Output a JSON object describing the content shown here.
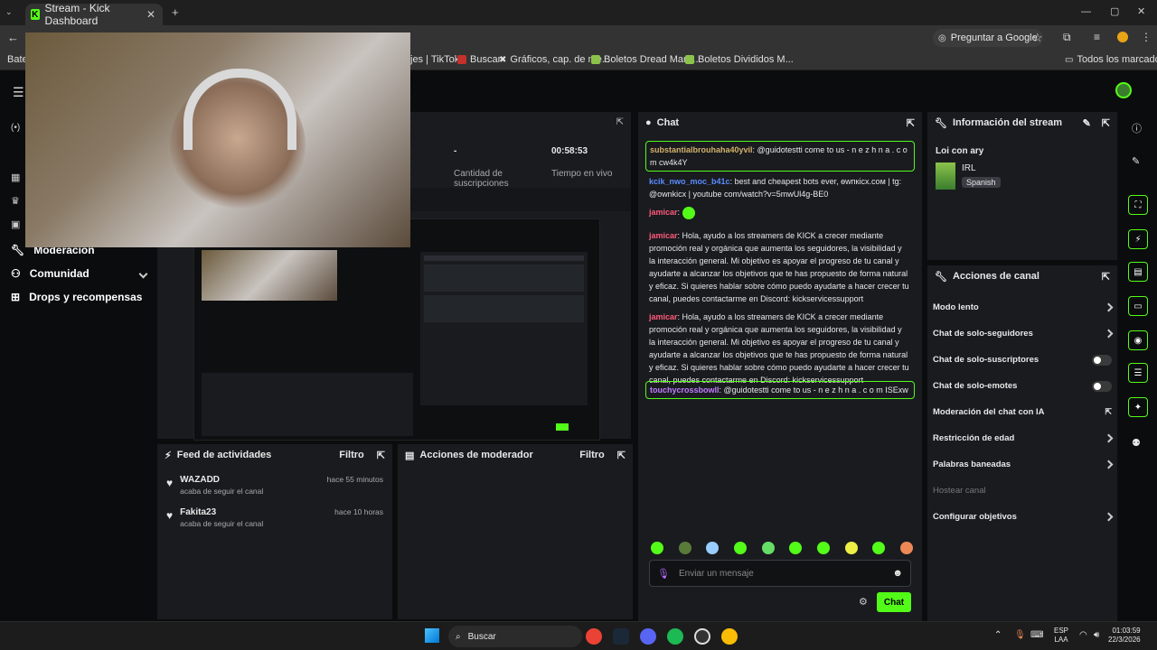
{
  "browser": {
    "tab_title": "Stream - Kick Dashboard",
    "ask_google": "Preguntar a Google",
    "bookmarks": [
      "Bater",
      "jes | TikTok",
      "Buscar",
      "Gráficos, cap. de me...",
      "Boletos Dread Mar-I...",
      "Boletos Divididos M..."
    ],
    "all_bookmarks": "Todos los marcadores"
  },
  "sidebar": {
    "items": [
      {
        "label": "Moderación",
        "icon": "wrench-icon"
      },
      {
        "label": "Comunidad",
        "icon": "people-icon"
      },
      {
        "label": "Drops y recompensas",
        "icon": "gift-icon"
      }
    ]
  },
  "stats": [
    {
      "value": "-",
      "label": "Cantidad de suscripciones"
    },
    {
      "value": "00:58:53",
      "label": "Tiempo en vivo"
    }
  ],
  "chat": {
    "title": "Chat",
    "messages": [
      {
        "user": "substantialbrouhaha40yvil",
        "color": "#d4b16a",
        "text": ": @guidotestti come to us - n e z h n a . c o m cw4k4Y",
        "highlight": true
      },
      {
        "user": "kcik_nwo_moc_b41c",
        "color": "#5b8cff",
        "text": ": best and cheapest bots ever, ѳwпкісх.сом | tg: @ownkicx | youtube com/watch?v=5mwUl4g-BE0",
        "highlight": false
      },
      {
        "user": "jamicar",
        "color": "#ff5a7a",
        "text": ": ",
        "highlight": false
      },
      {
        "user": "jamicar",
        "color": "#ff5a7a",
        "text": ": Hola, ayudo a los streamers de KICK a crecer mediante promoción real y orgánica que aumenta los seguidores, la visibilidad y la interacción general. Mi objetivo es apoyar el progreso de tu canal y ayudarte a alcanzar los objetivos que te has propuesto de forma natural y eficaz. Si quieres hablar sobre cómo puedo ayudarte a hacer crecer tu canal, puedes contactarme en Discord: kickservicessupport",
        "highlight": false
      },
      {
        "user": "jamicar",
        "color": "#ff5a7a",
        "text": ": Hola, ayudo a los streamers de KICK a crecer mediante promoción real y orgánica que aumenta los seguidores, la visibilidad y la interacción general. Mi objetivo es apoyar el progreso de tu canal y ayudarte a alcanzar los objetivos que te has propuesto de forma natural y eficaz. Si quieres hablar sobre cómo puedo ayudarte a hacer crecer tu canal, puedes contactarme en Discord: kickservicessupport",
        "highlight": false
      },
      {
        "user": "touchycrossbowll",
        "color": "#c07dff",
        "text": ": @guidotestti come to us - n e z h n a . c o m ISExw",
        "highlight": true
      }
    ],
    "input_placeholder": "Enviar un mensaje",
    "send_label": "Chat"
  },
  "stream_info": {
    "title": "Información del stream",
    "stream_title": "Loi con ary",
    "category": "IRL",
    "language": "Spanish"
  },
  "channel_actions": {
    "title": "Acciones de canal",
    "items": [
      {
        "label": "Modo lento",
        "control": "chevron"
      },
      {
        "label": "Chat de solo-seguidores",
        "control": "chevron"
      },
      {
        "label": "Chat de solo-suscriptores",
        "control": "toggle"
      },
      {
        "label": "Chat de solo-emotes",
        "control": "toggle"
      },
      {
        "label": "Moderación del chat con IA",
        "control": "external"
      },
      {
        "label": "Restricción de edad",
        "control": "chevron"
      },
      {
        "label": "Palabras baneadas",
        "control": "chevron"
      },
      {
        "label": "Hostear canal",
        "control": "disabled"
      },
      {
        "label": "Configurar objetivos",
        "control": "chevron"
      }
    ]
  },
  "activity_feed": {
    "title": "Feed de actividades",
    "filter": "Filtro",
    "events": [
      {
        "name": "WAZADD",
        "action": "acaba de seguir el canal",
        "time": "hace 55 minutos"
      },
      {
        "name": "Fakita23",
        "action": "acaba de seguir el canal",
        "time": "hace 10 horas"
      }
    ]
  },
  "mod_actions": {
    "title": "Acciones de moderador",
    "filter": "Filtro"
  },
  "taskbar": {
    "search": "Buscar",
    "lang_top": "ESP",
    "lang_bottom": "LAA",
    "time": "01:03:59",
    "date": "22/3/2026"
  },
  "colors": {
    "accent": "#53fc18",
    "panel": "#191b1f",
    "bg": "#0b0c0d"
  }
}
